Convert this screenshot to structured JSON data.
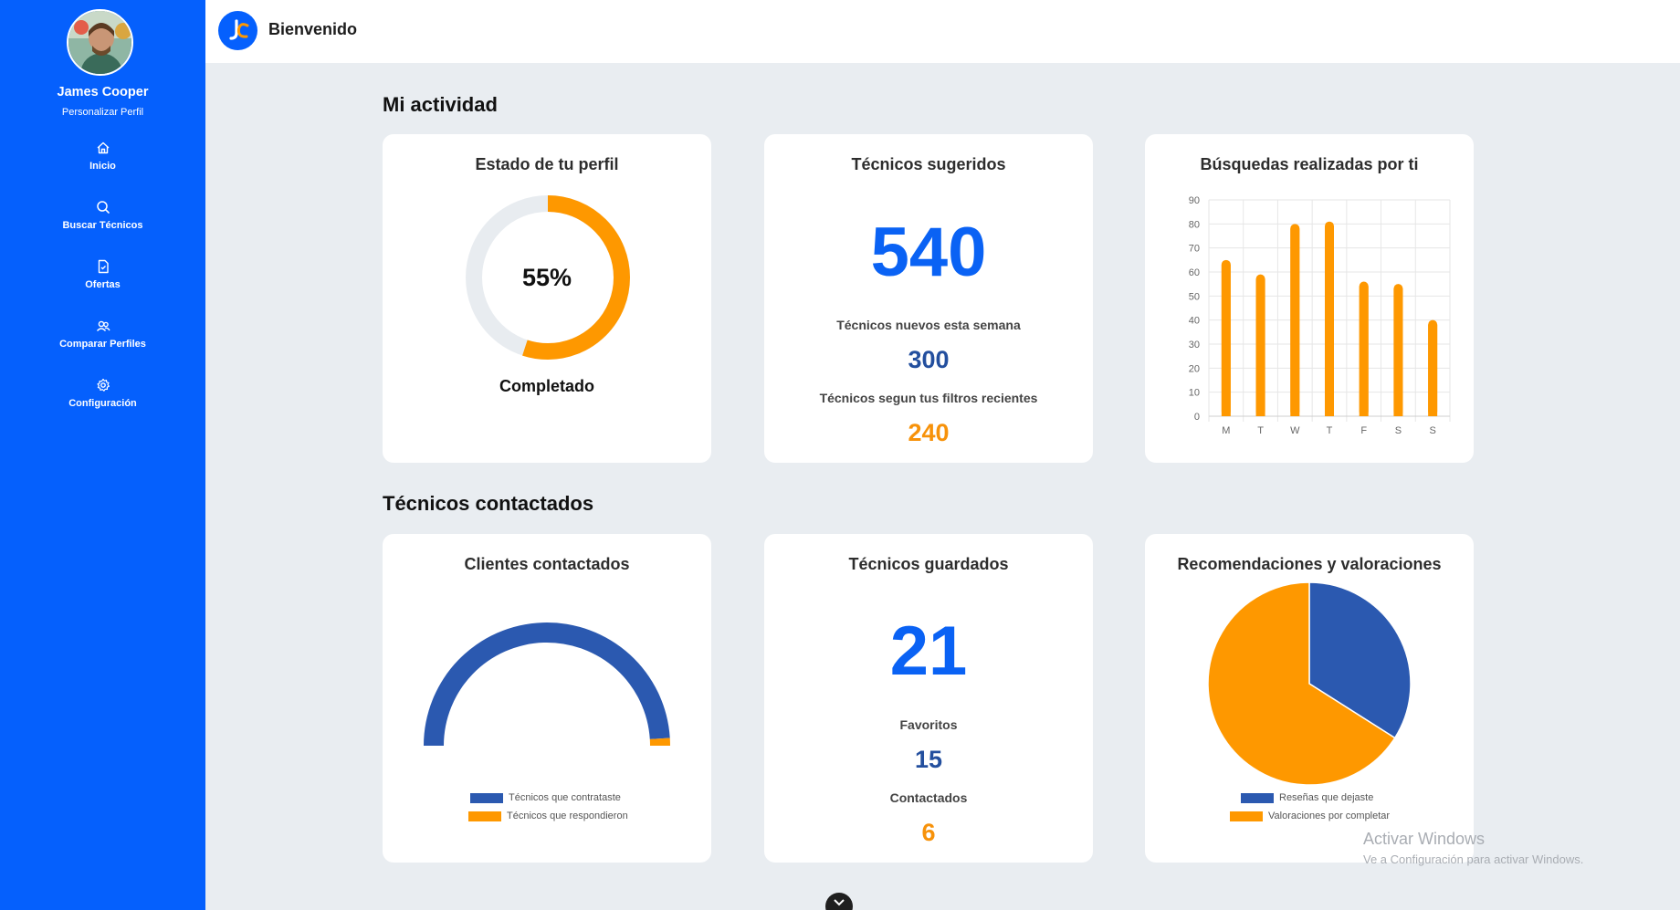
{
  "user": {
    "name": "James Cooper",
    "profile_link": "Personalizar Perfil"
  },
  "nav": [
    {
      "label": "Inicio",
      "icon": "home-icon"
    },
    {
      "label": "Buscar Técnicos",
      "icon": "search-icon"
    },
    {
      "label": "Ofertas",
      "icon": "document-icon"
    },
    {
      "label": "Comparar Perfiles",
      "icon": "users-icon"
    },
    {
      "label": "Configuración",
      "icon": "gear-icon"
    }
  ],
  "header": {
    "title": "Bienvenido"
  },
  "sections": {
    "activity": "Mi actividad",
    "contacted": "Técnicos contactados"
  },
  "profile_status": {
    "title": "Estado de tu perfil",
    "percent_label": "55%",
    "completed_label": "Completado",
    "progress": 0.55
  },
  "suggested": {
    "title": "Técnicos sugeridos",
    "total": "540",
    "new_label": "Técnicos nuevos esta semana",
    "new_value": "300",
    "filters_label": "Técnicos segun tus filtros recientes",
    "filters_value": "240"
  },
  "saved": {
    "title": "Técnicos guardados",
    "total": "21",
    "favorites_label": "Favoritos",
    "favorites_value": "15",
    "contacted_label": "Contactados",
    "contacted_value": "6"
  },
  "clients": {
    "title": "Clientes contactados",
    "legend": [
      "Técnicos que contrataste",
      "Técnicos que respondieron"
    ]
  },
  "reviews": {
    "title": "Recomendaciones y valoraciones",
    "legend": [
      "Reseñas que dejaste",
      "Valoraciones por completar"
    ]
  },
  "colors": {
    "blue": "#2b59b0",
    "orange": "#fe9800",
    "accent": "#0560fd"
  },
  "watermark": {
    "title": "Activar Windows",
    "subtitle": "Ve a Configuración para activar Windows."
  },
  "chart_data": [
    {
      "type": "bar",
      "title": "Búsquedas realizadas por ti",
      "categories": [
        "M",
        "T",
        "W",
        "T",
        "F",
        "S",
        "S"
      ],
      "values": [
        65,
        59,
        80,
        81,
        56,
        55,
        40
      ],
      "ylim": [
        0,
        90
      ],
      "yticks": [
        0,
        10,
        20,
        30,
        40,
        50,
        60,
        70,
        80,
        90
      ],
      "grid": true
    },
    {
      "type": "pie",
      "categories": [
        "Técnicos que contrataste",
        "Técnicos que respondieron"
      ],
      "values": [
        98,
        2
      ]
    },
    {
      "type": "pie",
      "categories": [
        "Reseñas que dejaste",
        "Valoraciones por completar"
      ],
      "values": [
        34,
        66
      ]
    }
  ]
}
